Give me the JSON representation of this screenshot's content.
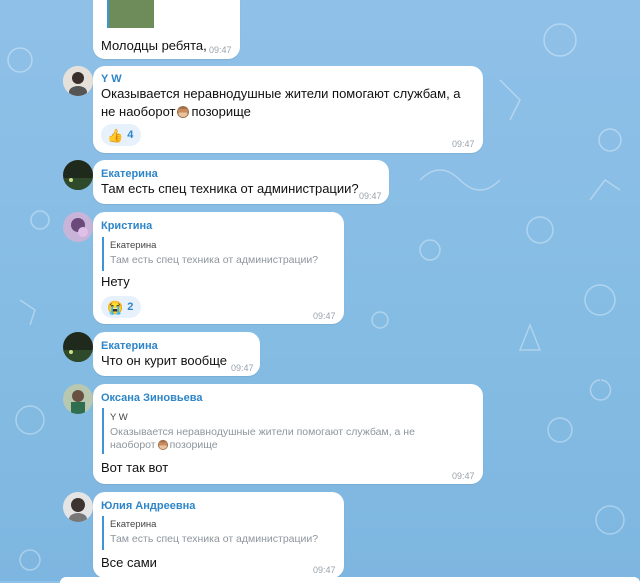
{
  "messages": [
    {
      "text": "Молодцы ребята,",
      "time": "09:47"
    },
    {
      "sender": "Y W",
      "text_line1": "Оказывается неравнодушные жители помогают службам, а",
      "text_line2_a": "не наоборот",
      "text_line2_b": "позорище",
      "reaction_emoji": "👍",
      "reaction_count": "4",
      "time": "09:47"
    },
    {
      "sender": "Екатерина",
      "text": "Там есть спец техника от администрации?",
      "time": "09:47"
    },
    {
      "sender": "Кристина",
      "reply_name": "Екатерина",
      "reply_text": "Там есть спец техника от администрации?",
      "text": "Нету",
      "reaction_emoji": "😭",
      "reaction_count": "2",
      "time": "09:47"
    },
    {
      "sender": "Екатерина",
      "text": "Что он курит вообще",
      "time": "09:47"
    },
    {
      "sender": "Оксана Зиновьева",
      "reply_name": "Y W",
      "reply_line1": "Оказывается неравнодушные жители помогают службам, а не",
      "reply_line2_a": "наоборот",
      "reply_line2_b": "позорище",
      "text": "Вот так вот",
      "time": "09:47"
    },
    {
      "sender": "Юлия Андреевна",
      "reply_name": "Екатерина",
      "reply_text": "Там есть спец техника от администрации?",
      "text": "Все сами",
      "time": "09:47"
    }
  ],
  "icons": {
    "monkey": "see-no-evil-monkey-emoji",
    "thumbs": "thumbs-up-emoji",
    "crying": "loudly-crying-emoji"
  },
  "colors": {
    "background": "#86bde4",
    "bubble": "#ffffff",
    "sender": "#2e86c9",
    "reply_bar": "#3e95d6",
    "reaction_bg": "#e7f1fb"
  }
}
